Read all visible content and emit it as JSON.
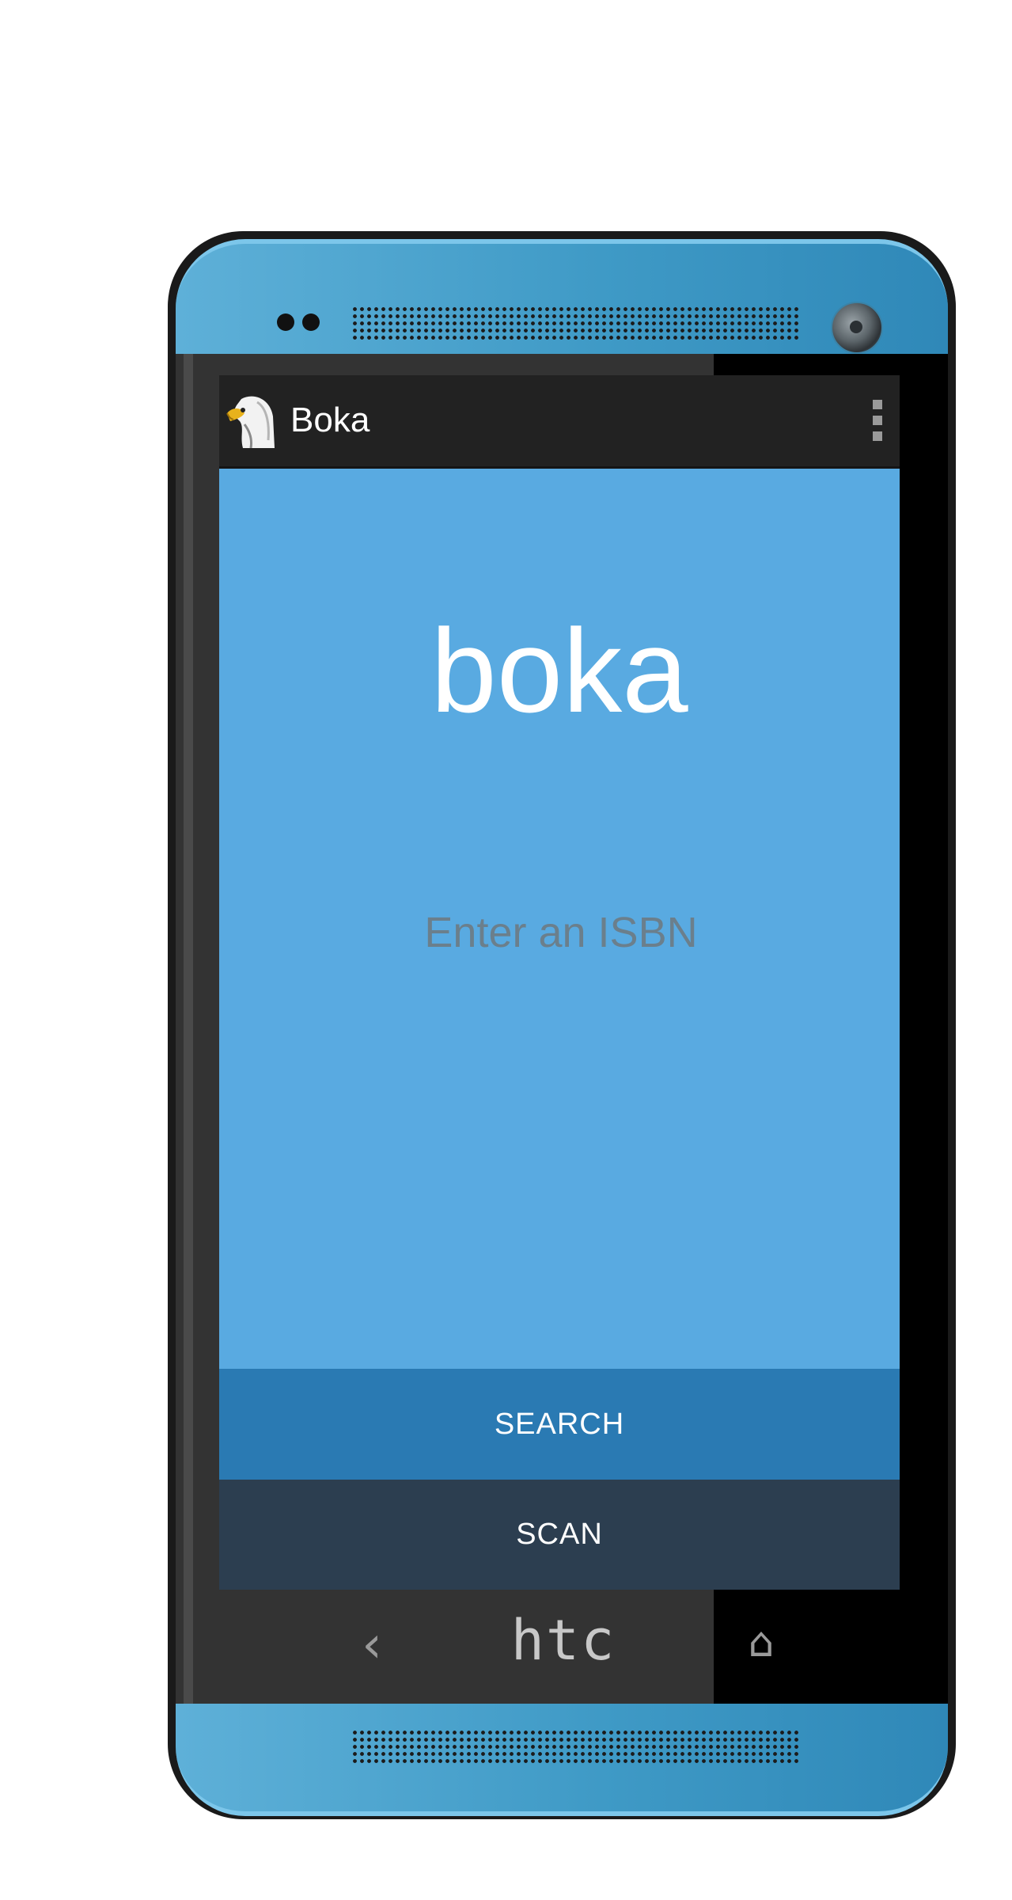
{
  "app": {
    "title": "Boka",
    "logo_text": "boka",
    "isbn_placeholder": "Enter an ISBN",
    "search_label": "SEARCH",
    "scan_label": "SCAN",
    "overflow_icon": "overflow-menu-icon",
    "app_icon": "eagle-icon"
  },
  "device": {
    "brand": "htc",
    "back_icon": "back-icon",
    "home_icon": "home-icon"
  },
  "colors": {
    "screen_bg": "#59aae1",
    "actionbar_bg": "#222222",
    "search_bg": "#2a7ab3",
    "scan_bg": "#2c3e50",
    "shell": "#3f9ac6"
  }
}
